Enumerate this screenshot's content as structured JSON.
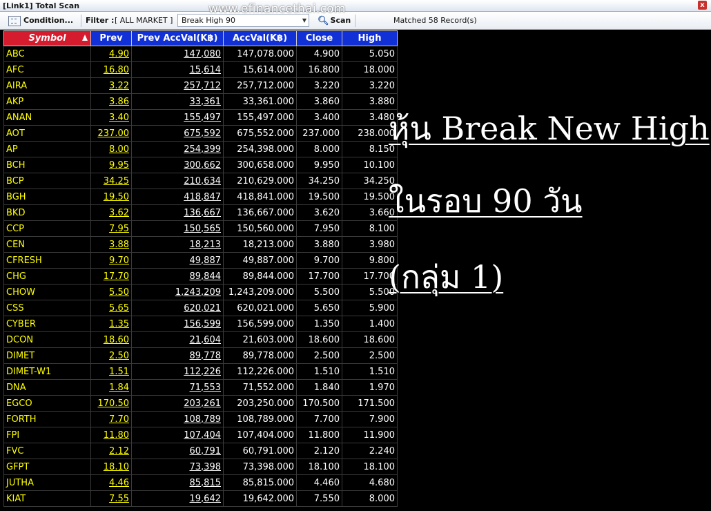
{
  "window": {
    "title": "[Link1] Total Scan",
    "close_glyph": "x"
  },
  "toolbar": {
    "condition_label": "Condition...",
    "filter_label": "Filter :",
    "filter_value": "[ ALL MARKET ]",
    "scan_selection": "Break High 90",
    "scan_label": "Scan",
    "matched_text": "Matched 58 Record(s)"
  },
  "watermark": "www.efinancethai.com",
  "table": {
    "columns": [
      "Symbol",
      "Prev",
      "Prev AccVal(K฿)",
      "AccVal(K฿)",
      "Close",
      "High"
    ],
    "rows": [
      [
        "ABC",
        "4.90",
        "147,080",
        "147,078.000",
        "4.900",
        "5.050"
      ],
      [
        "AFC",
        "16.80",
        "15,614",
        "15,614.000",
        "16.800",
        "18.000"
      ],
      [
        "AIRA",
        "3.22",
        "257,712",
        "257,712.000",
        "3.220",
        "3.220"
      ],
      [
        "AKP",
        "3.86",
        "33,361",
        "33,361.000",
        "3.860",
        "3.880"
      ],
      [
        "ANAN",
        "3.40",
        "155,497",
        "155,497.000",
        "3.400",
        "3.480"
      ],
      [
        "AOT",
        "237.00",
        "675,592",
        "675,552.000",
        "237.000",
        "238.000"
      ],
      [
        "AP",
        "8.00",
        "254,399",
        "254,398.000",
        "8.000",
        "8.150"
      ],
      [
        "BCH",
        "9.95",
        "300,662",
        "300,658.000",
        "9.950",
        "10.100"
      ],
      [
        "BCP",
        "34.25",
        "210,634",
        "210,629.000",
        "34.250",
        "34.250"
      ],
      [
        "BGH",
        "19.50",
        "418,847",
        "418,841.000",
        "19.500",
        "19.500"
      ],
      [
        "BKD",
        "3.62",
        "136,667",
        "136,667.000",
        "3.620",
        "3.660"
      ],
      [
        "CCP",
        "7.95",
        "150,565",
        "150,560.000",
        "7.950",
        "8.100"
      ],
      [
        "CEN",
        "3.88",
        "18,213",
        "18,213.000",
        "3.880",
        "3.980"
      ],
      [
        "CFRESH",
        "9.70",
        "49,887",
        "49,887.000",
        "9.700",
        "9.800"
      ],
      [
        "CHG",
        "17.70",
        "89,844",
        "89,844.000",
        "17.700",
        "17.700"
      ],
      [
        "CHOW",
        "5.50",
        "1,243,209",
        "1,243,209.000",
        "5.500",
        "5.500"
      ],
      [
        "CSS",
        "5.65",
        "620,021",
        "620,021.000",
        "5.650",
        "5.900"
      ],
      [
        "CYBER",
        "1.35",
        "156,599",
        "156,599.000",
        "1.350",
        "1.400"
      ],
      [
        "DCON",
        "18.60",
        "21,604",
        "21,603.000",
        "18.600",
        "18.600"
      ],
      [
        "DIMET",
        "2.50",
        "89,778",
        "89,778.000",
        "2.500",
        "2.500"
      ],
      [
        "DIMET-W1",
        "1.51",
        "112,226",
        "112,226.000",
        "1.510",
        "1.510"
      ],
      [
        "DNA",
        "1.84",
        "71,553",
        "71,552.000",
        "1.840",
        "1.970"
      ],
      [
        "EGCO",
        "170.50",
        "203,261",
        "203,250.000",
        "170.500",
        "171.500"
      ],
      [
        "FORTH",
        "7.70",
        "108,789",
        "108,789.000",
        "7.700",
        "7.900"
      ],
      [
        "FPI",
        "11.80",
        "107,404",
        "107,404.000",
        "11.800",
        "11.900"
      ],
      [
        "FVC",
        "2.12",
        "60,791",
        "60,791.000",
        "2.120",
        "2.240"
      ],
      [
        "GFPT",
        "18.10",
        "73,398",
        "73,398.000",
        "18.100",
        "18.100"
      ],
      [
        "JUTHA",
        "4.46",
        "85,815",
        "85,815.000",
        "4.460",
        "4.680"
      ],
      [
        "KIAT",
        "7.55",
        "19,642",
        "19,642.000",
        "7.550",
        "8.000"
      ]
    ]
  },
  "overlay": {
    "line1": "หุ้น Break New High",
    "line2": "ในรอบ 90 วัน",
    "line3": "(กลุ่ม 1)"
  },
  "colors": {
    "header_blue": "#1131d6",
    "header_red": "#d51c2e",
    "price_yellow": "#ffff00",
    "background": "#000000"
  }
}
